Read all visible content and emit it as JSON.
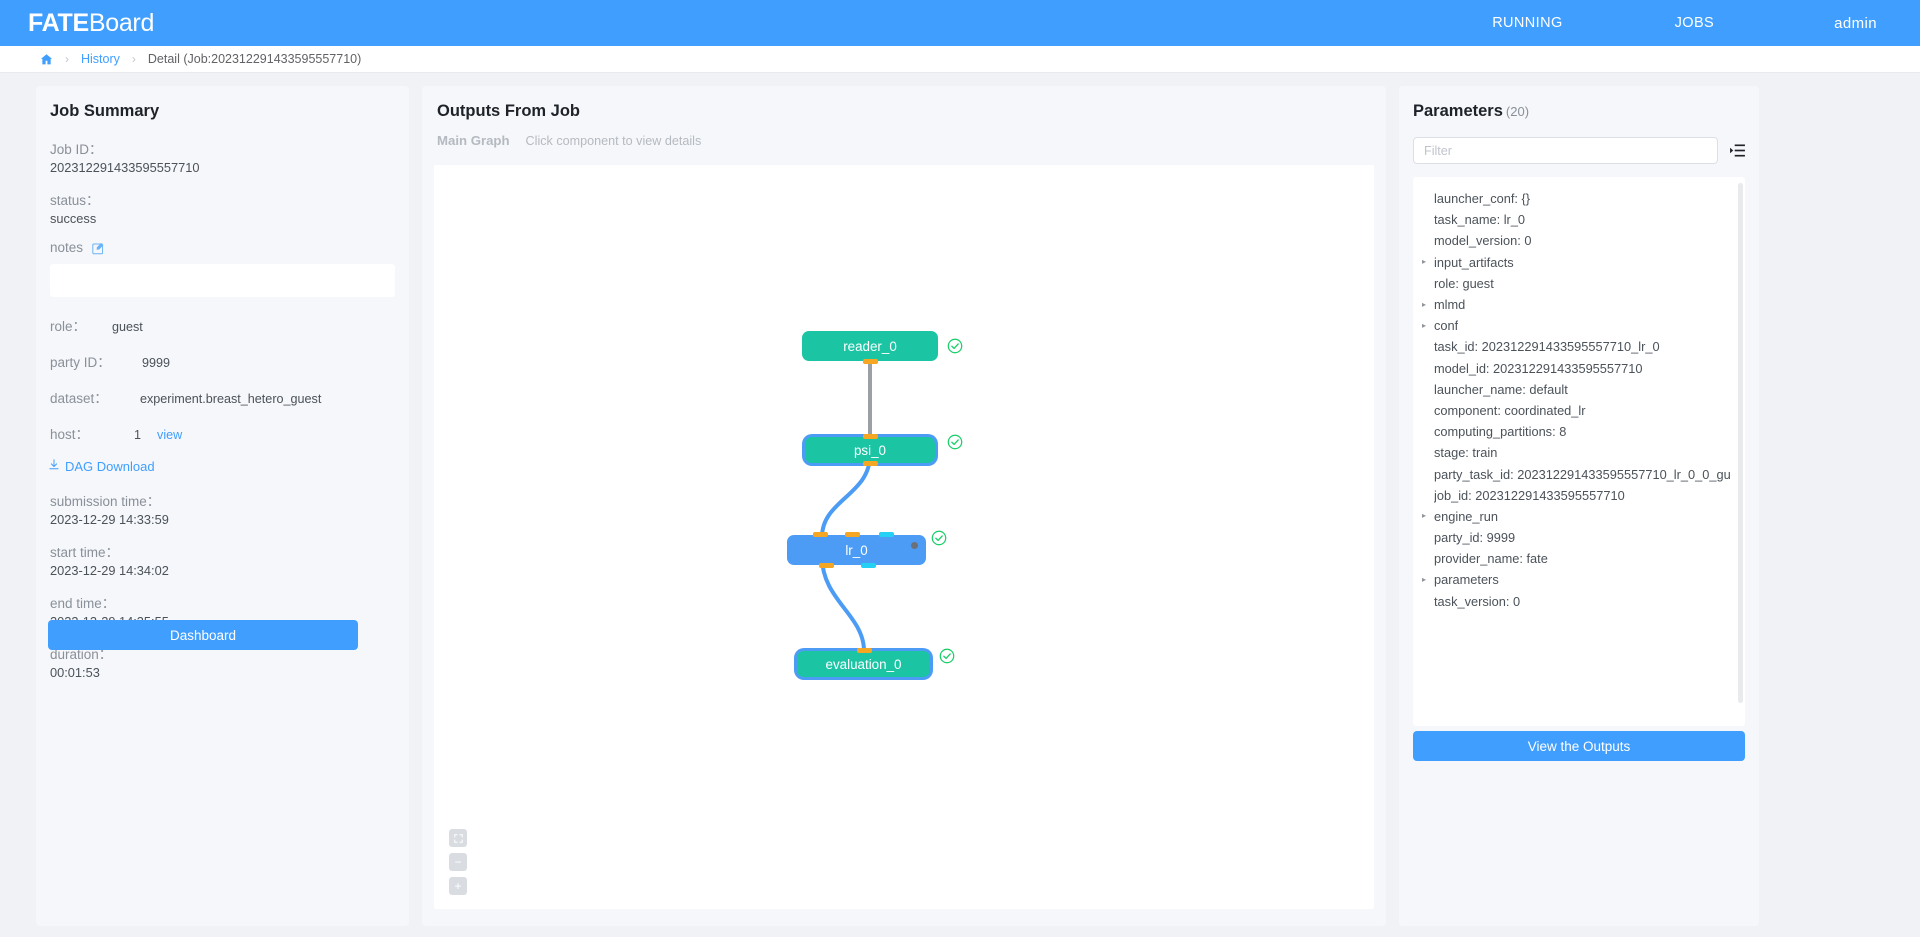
{
  "header": {
    "brand_bold": "FATE",
    "brand_light": "Board",
    "nav": {
      "running": "RUNNING",
      "jobs": "JOBS",
      "user": "admin"
    },
    "accent_color": "#409eff"
  },
  "breadcrumb": {
    "home_icon": "home-icon",
    "separator": "›",
    "history": "History",
    "current": "Detail (Job:202312291433595557710)"
  },
  "summary": {
    "title": "Job Summary",
    "job_id_label": "Job ID：",
    "job_id_value": "202312291433595557710",
    "status_label": "status：",
    "status_value": "success",
    "notes_label": "notes",
    "notes_value": "",
    "role_label": "role：",
    "role_value": "guest",
    "party_id_label": "party ID：",
    "party_id_value": "9999",
    "dataset_label": "dataset：",
    "dataset_value": "experiment.breast_hetero_guest",
    "host_label": "host：",
    "host_value": "1",
    "host_view_link": "view",
    "dag_download": "DAG Download",
    "submission_time_label": "submission time：",
    "submission_time_value": "2023-12-29 14:33:59",
    "start_time_label": "start time：",
    "start_time_value": "2023-12-29 14:34:02",
    "end_time_label": "end time：",
    "end_time_value": "2023-12-29 14:35:55",
    "duration_label": "duration：",
    "duration_value": "00:01:53",
    "dashboard_button": "Dashboard"
  },
  "outputs": {
    "title": "Outputs From Job",
    "tab_main_graph": "Main Graph",
    "hint": "Click component to view details",
    "zoom_controls": [
      {
        "name": "fit-screen-button",
        "label": ""
      },
      {
        "name": "zoom-out-button",
        "label": "−"
      },
      {
        "name": "zoom-in-button",
        "label": "+"
      }
    ],
    "graph": {
      "nodes": [
        {
          "id": "reader_0",
          "label": "reader_0",
          "color": "teal",
          "selected": false,
          "status": "success"
        },
        {
          "id": "psi_0",
          "label": "psi_0",
          "color": "teal",
          "selected": true,
          "status": "success"
        },
        {
          "id": "lr_0",
          "label": "lr_0",
          "color": "blue",
          "selected": false,
          "status": "success"
        },
        {
          "id": "evaluation_0",
          "label": "evaluation_0",
          "color": "teal",
          "selected": true,
          "status": "success"
        }
      ],
      "edges": [
        {
          "from": "reader_0",
          "to": "psi_0",
          "color": "#9aa0a6"
        },
        {
          "from": "psi_0",
          "to": "lr_0",
          "color": "#4c9cf5"
        },
        {
          "from": "lr_0",
          "to": "evaluation_0",
          "color": "#4c9cf5"
        }
      ],
      "port_colors": {
        "input": "#f5a623",
        "output": "#25d0f5"
      },
      "status_icon_color": "#13ce66"
    }
  },
  "parameters": {
    "title": "Parameters",
    "count": "(20)",
    "filter_placeholder": "Filter",
    "filter_value": "",
    "filter_icon": "list-indent-icon",
    "view_outputs_button": "View the Outputs",
    "items": [
      {
        "text": "launcher_conf: {}",
        "expandable": false
      },
      {
        "text": "task_name: lr_0",
        "expandable": false
      },
      {
        "text": "model_version: 0",
        "expandable": false
      },
      {
        "text": "input_artifacts",
        "expandable": true
      },
      {
        "text": "role: guest",
        "expandable": false
      },
      {
        "text": "mlmd",
        "expandable": true
      },
      {
        "text": "conf",
        "expandable": true
      },
      {
        "text": "task_id: 202312291433595557710_lr_0",
        "expandable": false
      },
      {
        "text": "model_id: 202312291433595557710",
        "expandable": false
      },
      {
        "text": "launcher_name: default",
        "expandable": false
      },
      {
        "text": "component: coordinated_lr",
        "expandable": false
      },
      {
        "text": "computing_partitions: 8",
        "expandable": false
      },
      {
        "text": "stage: train",
        "expandable": false
      },
      {
        "text": "party_task_id: 202312291433595557710_lr_0_0_gu",
        "expandable": false
      },
      {
        "text": "job_id: 202312291433595557710",
        "expandable": false
      },
      {
        "text": "engine_run",
        "expandable": true
      },
      {
        "text": "party_id: 9999",
        "expandable": false
      },
      {
        "text": "provider_name: fate",
        "expandable": false
      },
      {
        "text": "parameters",
        "expandable": true
      },
      {
        "text": "task_version: 0",
        "expandable": false
      }
    ]
  }
}
